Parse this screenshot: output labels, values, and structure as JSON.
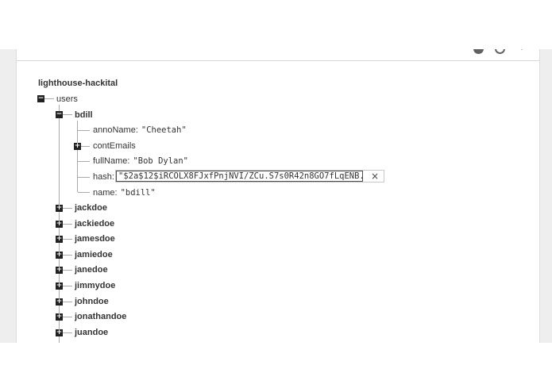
{
  "tree": {
    "root": "lighthouse-hackital",
    "users_label": "users",
    "expanded_user": {
      "key": "bdill",
      "children": {
        "anno_key": "annoName:",
        "anno_val": "\"Cheetah\"",
        "cont_key": "contEmails",
        "full_key": "fullName:",
        "full_val": "\"Bob Dylan\"",
        "hash_key": "hash:",
        "hash_val": "\"$2a$12$iRCOLX8FJxfPnjNVI/ZCu.S7s0R42n8GO7fLqENB...\"",
        "name_key": "name:",
        "name_val": "\"bdill\""
      }
    },
    "collapsed_users": [
      "jackdoe",
      "jackiedoe",
      "jamesdoe",
      "jamiedoe",
      "janedoe",
      "jimmydoe",
      "johndoe",
      "jonathandoe",
      "juandoe"
    ],
    "expand_symbol": "+",
    "collapse_symbol": "−",
    "close_symbol": "×"
  }
}
